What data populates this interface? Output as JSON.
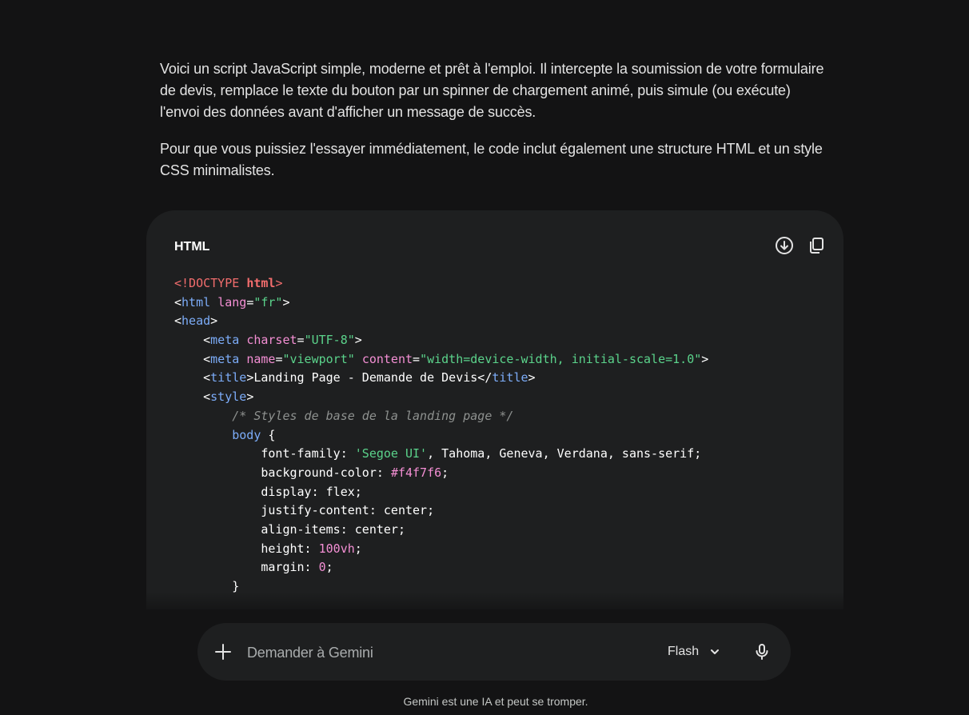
{
  "response": {
    "paragraphs": [
      "Voici un script JavaScript simple, moderne et prêt à l'emploi. Il intercepte la soumission de votre formulaire de devis, remplace le texte du bouton par un spinner de chargement animé, puis simule (ou exécute) l'envoi des données avant d'afficher un message de succès.",
      "Pour que vous puissiez l'essayer immédiatement, le code inclut également une structure HTML et un style CSS minimalistes."
    ]
  },
  "code_block": {
    "language": "HTML",
    "download_icon": "download-circle-icon",
    "copy_icon": "copy-icon",
    "lines": [
      [
        [
          "doc",
          "<!DOCTYPE "
        ],
        [
          "docb",
          "html"
        ],
        [
          "doc",
          ">"
        ]
      ],
      [
        [
          "pl",
          "<"
        ],
        [
          "tag",
          "html"
        ],
        [
          "pl",
          " "
        ],
        [
          "attr",
          "lang"
        ],
        [
          "pl",
          "="
        ],
        [
          "str",
          "\"fr\""
        ],
        [
          "pl",
          ">"
        ]
      ],
      [
        [
          "pl",
          "<"
        ],
        [
          "tag",
          "head"
        ],
        [
          "pl",
          ">"
        ]
      ],
      [
        [
          "pl",
          "    <"
        ],
        [
          "tag",
          "meta"
        ],
        [
          "pl",
          " "
        ],
        [
          "attr",
          "charset"
        ],
        [
          "pl",
          "="
        ],
        [
          "str",
          "\"UTF-8\""
        ],
        [
          "pl",
          ">"
        ]
      ],
      [
        [
          "pl",
          "    <"
        ],
        [
          "tag",
          "meta"
        ],
        [
          "pl",
          " "
        ],
        [
          "attr",
          "name"
        ],
        [
          "pl",
          "="
        ],
        [
          "str",
          "\"viewport\""
        ],
        [
          "pl",
          " "
        ],
        [
          "attr",
          "content"
        ],
        [
          "pl",
          "="
        ],
        [
          "str",
          "\"width=device-width, initial-scale=1.0\""
        ],
        [
          "pl",
          ">"
        ]
      ],
      [
        [
          "pl",
          "    <"
        ],
        [
          "tag",
          "title"
        ],
        [
          "pl",
          ">Landing Page - Demande de Devis</"
        ],
        [
          "tag",
          "title"
        ],
        [
          "pl",
          ">"
        ]
      ],
      [
        [
          "pl",
          "    <"
        ],
        [
          "tag",
          "style"
        ],
        [
          "pl",
          ">"
        ]
      ],
      [
        [
          "pl",
          "        "
        ],
        [
          "com",
          "/* Styles de base de la landing page */"
        ]
      ],
      [
        [
          "pl",
          "        "
        ],
        [
          "sel",
          "body"
        ],
        [
          "pl",
          " {"
        ]
      ],
      [
        [
          "pl",
          "            font-family: "
        ],
        [
          "str",
          "'Segoe UI'"
        ],
        [
          "pl",
          ", Tahoma, Geneva, Verdana, sans-serif;"
        ]
      ],
      [
        [
          "pl",
          "            background-color: "
        ],
        [
          "num",
          "#f4f7f6"
        ],
        [
          "pl",
          ";"
        ]
      ],
      [
        [
          "pl",
          "            display: flex;"
        ]
      ],
      [
        [
          "pl",
          "            justify-content: center;"
        ]
      ],
      [
        [
          "pl",
          "            align-items: center;"
        ]
      ],
      [
        [
          "pl",
          "            height: "
        ],
        [
          "num",
          "100vh"
        ],
        [
          "pl",
          ";"
        ]
      ],
      [
        [
          "pl",
          "            margin: "
        ],
        [
          "num",
          "0"
        ],
        [
          "pl",
          ";"
        ]
      ],
      [
        [
          "pl",
          "        }"
        ]
      ]
    ]
  },
  "composer": {
    "plus_icon": "plus-icon",
    "placeholder": "Demander à Gemini",
    "model_label": "Flash",
    "chevron_icon": "chevron-down-icon",
    "mic_icon": "mic-icon"
  },
  "disclaimer": "Gemini est une IA et peut se tromper.",
  "colors": {
    "background": "#131314",
    "surface": "#1e1f20",
    "text": "#e3e3e3",
    "tag": "#7cacf8",
    "attribute": "#f48fd4",
    "string": "#5bd38b",
    "doctype": "#f26d6d",
    "comment": "#8e918f"
  }
}
